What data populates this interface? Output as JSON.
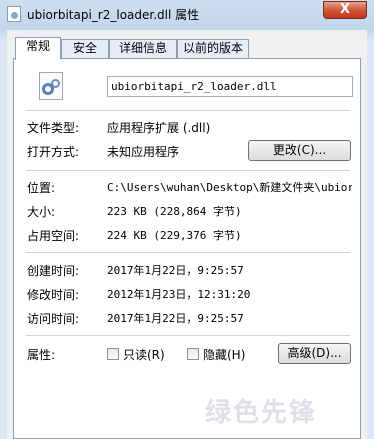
{
  "window": {
    "title": "ubiorbitapi_r2_loader.dll 属性",
    "close_label": "X"
  },
  "tabs": [
    {
      "label": "常规",
      "active": true
    },
    {
      "label": "安全",
      "active": false
    },
    {
      "label": "详细信息",
      "active": false
    },
    {
      "label": "以前的版本",
      "active": false
    }
  ],
  "general": {
    "file_name": "ubiorbitapi_r2_loader.dll",
    "file_type_label": "文件类型:",
    "file_type_value": "应用程序扩展 (.dll)",
    "opens_with_label": "打开方式:",
    "opens_with_value": "未知应用程序",
    "change_button": "更改(C)...",
    "location_label": "位置:",
    "location_value": "C:\\Users\\wuhan\\Desktop\\新建文件夹\\ubiorbi",
    "size_label": "大小:",
    "size_value": "223 KB (228,864 字节)",
    "size_on_disk_label": "占用空间:",
    "size_on_disk_value": "224 KB (229,376 字节)",
    "created_label": "创建时间:",
    "created_value": "2017年1月22日，9:25:57",
    "modified_label": "修改时间:",
    "modified_value": "2012年1月23日，12:31:20",
    "accessed_label": "访问时间:",
    "accessed_value": "2017年1月22日，9:25:57",
    "attributes_label": "属性:",
    "readonly_label": "只读(R)",
    "hidden_label": "隐藏(H)",
    "advanced_button": "高级(D)..."
  },
  "watermark_text": "绿色先锋",
  "colors": {
    "close_button": "#c0391d",
    "window_frame": "#c2d6ec"
  }
}
